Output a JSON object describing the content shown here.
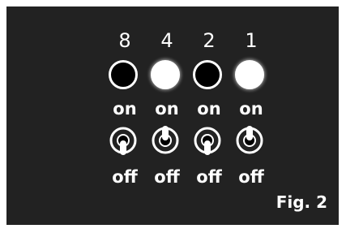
{
  "columns": [
    {
      "bit": "8",
      "led": "off",
      "on_label": "on",
      "off_label": "off",
      "switch_state": "off"
    },
    {
      "bit": "4",
      "led": "on",
      "on_label": "on",
      "off_label": "off",
      "switch_state": "on"
    },
    {
      "bit": "2",
      "led": "off",
      "on_label": "on",
      "off_label": "off",
      "switch_state": "off"
    },
    {
      "bit": "1",
      "led": "on",
      "on_label": "on",
      "off_label": "off",
      "switch_state": "on"
    }
  ],
  "figure_label": "Fig. 2",
  "colors": {
    "panel": "#222222",
    "foreground": "#ffffff",
    "led_off_fill": "#000000"
  }
}
